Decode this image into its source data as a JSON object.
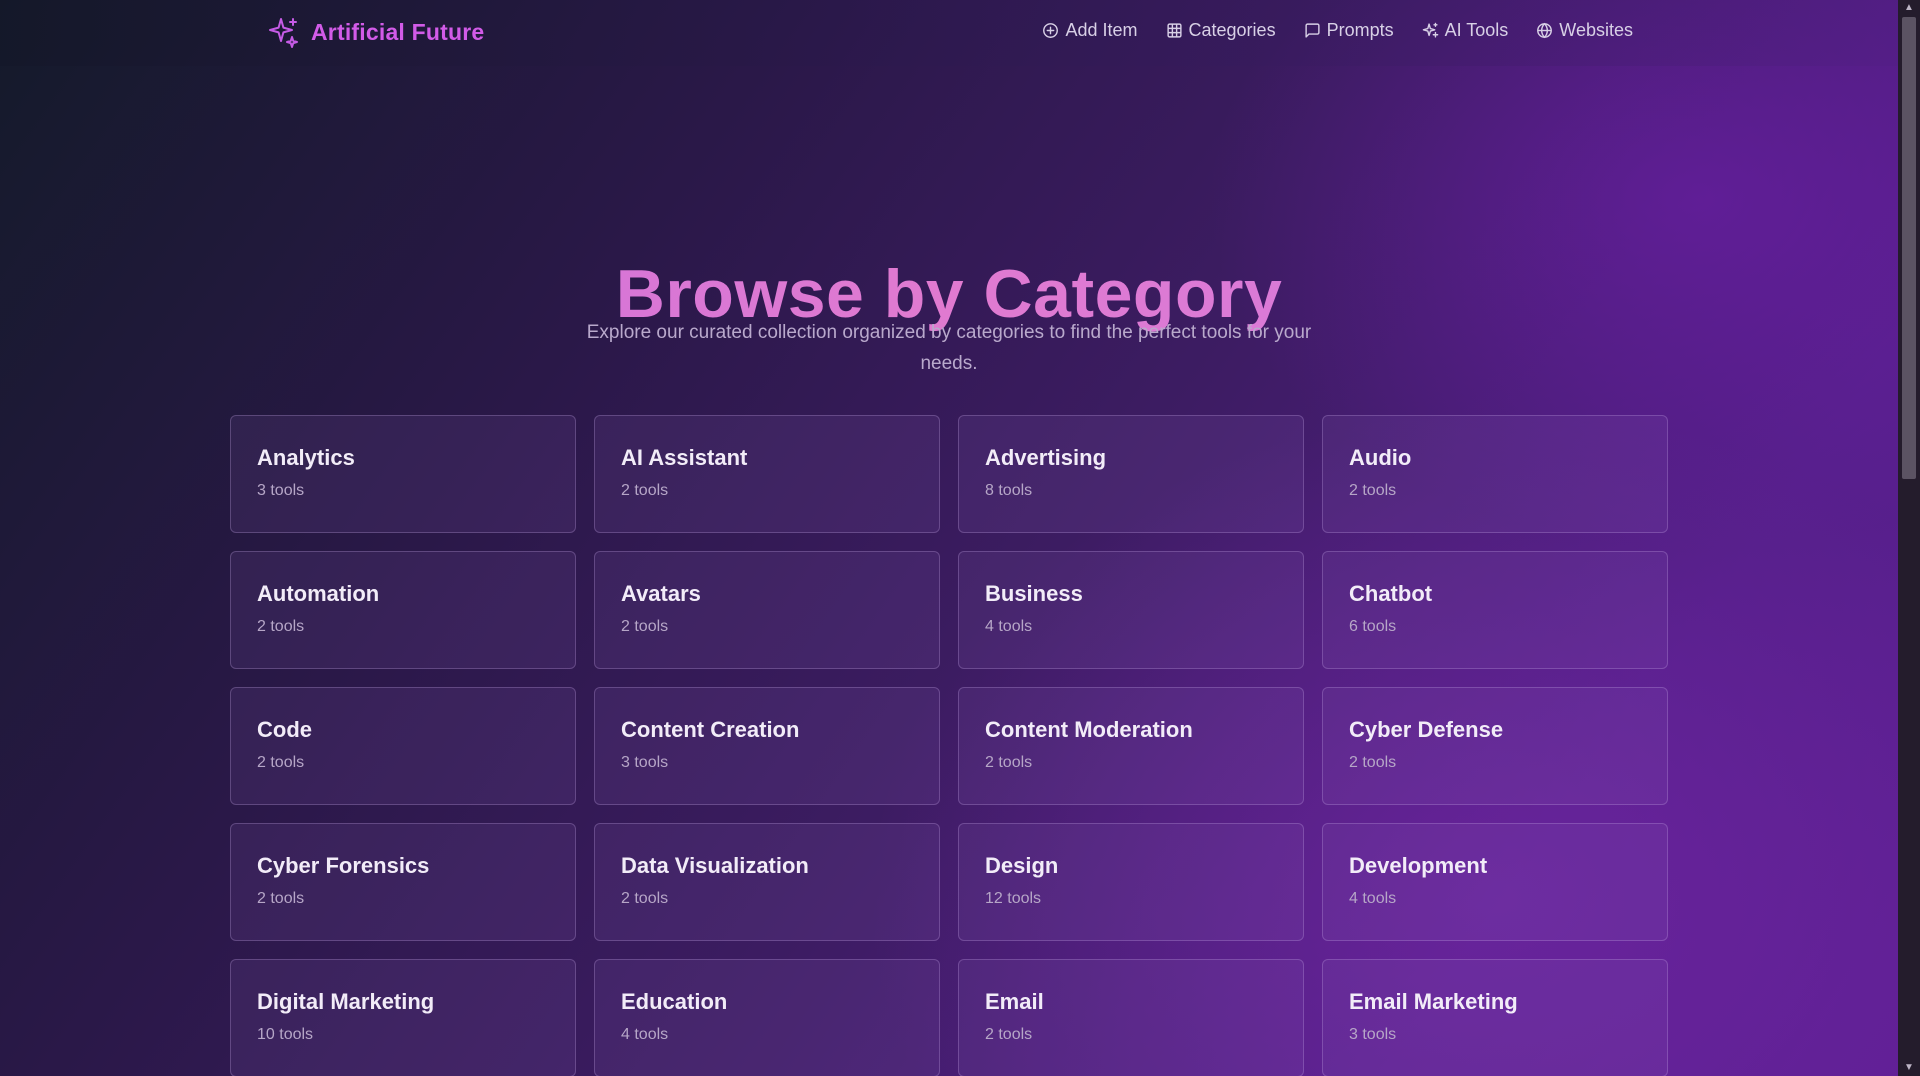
{
  "nav": {
    "brand": "Artificial Future",
    "brand_icon": "sparkles-icon",
    "brand_color": "#d25be8",
    "links": [
      {
        "label": "Add Item",
        "icon": "plus-circle-icon"
      },
      {
        "label": "Categories",
        "icon": "grid-icon"
      },
      {
        "label": "Prompts",
        "icon": "message-square-icon"
      },
      {
        "label": "AI Tools",
        "icon": "sparkles-icon"
      },
      {
        "label": "Websites",
        "icon": "globe-icon"
      }
    ]
  },
  "hero": {
    "title": "Browse by Category",
    "subtitle": "Explore our curated collection organized by categories to find the perfect tools for your needs."
  },
  "categories": [
    {
      "name": "Analytics",
      "count": "3 tools"
    },
    {
      "name": "AI Assistant",
      "count": "2 tools"
    },
    {
      "name": "Advertising",
      "count": "8 tools"
    },
    {
      "name": "Audio",
      "count": "2 tools"
    },
    {
      "name": "Automation",
      "count": "2 tools"
    },
    {
      "name": "Avatars",
      "count": "2 tools"
    },
    {
      "name": "Business",
      "count": "4 tools"
    },
    {
      "name": "Chatbot",
      "count": "6 tools"
    },
    {
      "name": "Code",
      "count": "2 tools"
    },
    {
      "name": "Content Creation",
      "count": "3 tools"
    },
    {
      "name": "Content Moderation",
      "count": "2 tools"
    },
    {
      "name": "Cyber Defense",
      "count": "2 tools"
    },
    {
      "name": "Cyber Forensics",
      "count": "2 tools"
    },
    {
      "name": "Data Visualization",
      "count": "2 tools"
    },
    {
      "name": "Design",
      "count": "12 tools"
    },
    {
      "name": "Development",
      "count": "4 tools"
    },
    {
      "name": "Digital Marketing",
      "count": "10 tools"
    },
    {
      "name": "Education",
      "count": "4 tools"
    },
    {
      "name": "Email",
      "count": "2 tools"
    },
    {
      "name": "Email Marketing",
      "count": "3 tools"
    }
  ],
  "colors": {
    "title_gradient_start": "#c96fe0",
    "title_gradient_end": "#d07be4",
    "background_dark": "#141a2a",
    "background_purple": "#5e1f94"
  }
}
